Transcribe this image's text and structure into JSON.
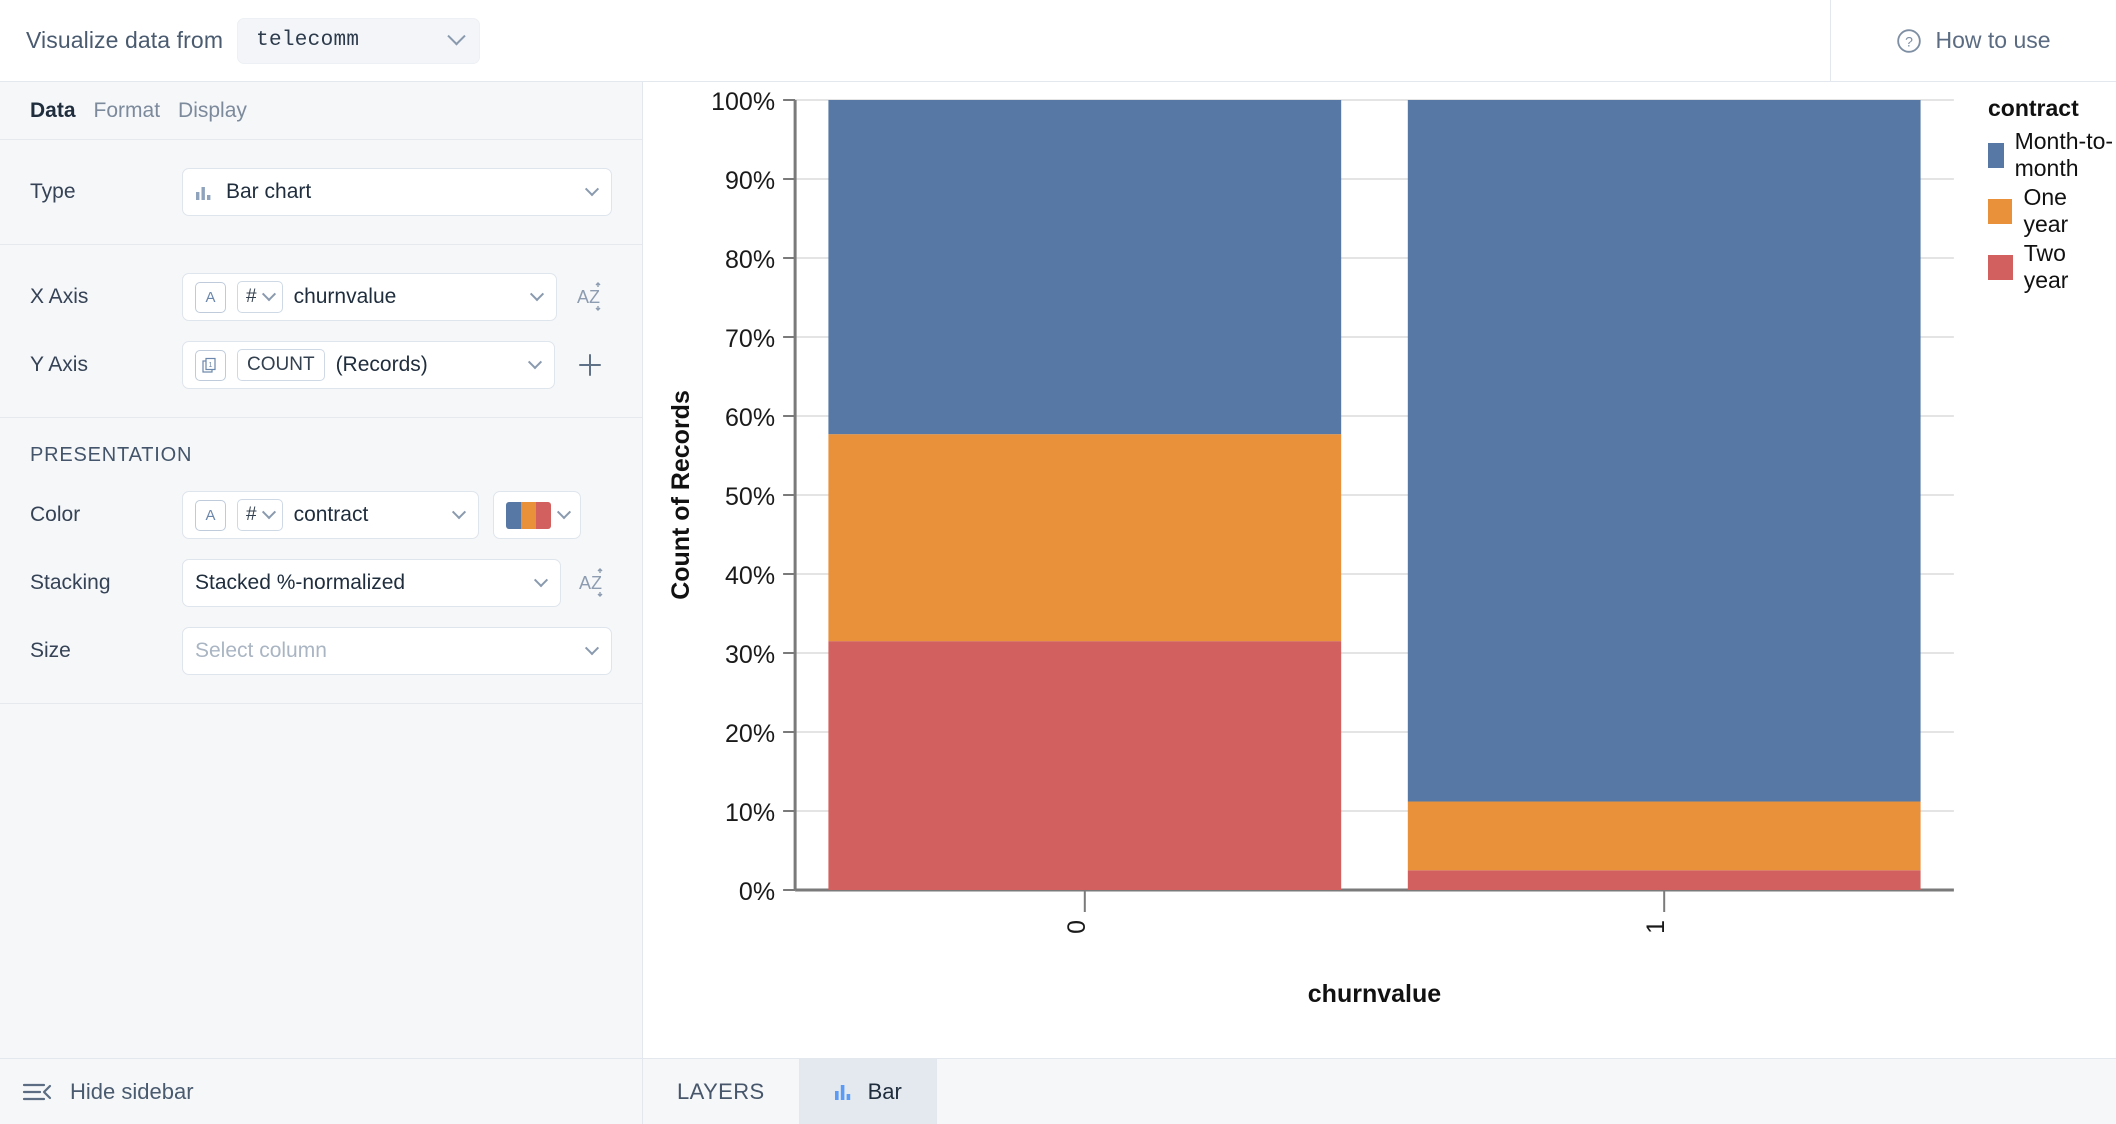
{
  "topbar": {
    "visualize_label": "Visualize data from",
    "dataset": "telecomm",
    "dataset_chevron_icon": "chevron-down-icon",
    "help_icon": "question-circle-icon",
    "help_label": "How to use"
  },
  "sidebar": {
    "tabs": [
      {
        "label": "Data",
        "active": true
      },
      {
        "label": "Format",
        "active": false
      },
      {
        "label": "Display",
        "active": false
      }
    ],
    "type_row": {
      "label": "Type",
      "icon": "bar-chart-icon",
      "value": "Bar chart"
    },
    "x_axis_row": {
      "label": "X Axis",
      "type_icon": "text-type-icon",
      "type_badge": "A",
      "agg_badge": "#",
      "value": "churnvalue",
      "sort_icon": "sort-az-icon"
    },
    "y_axis_row": {
      "label": "Y Axis",
      "type_icon": "layers-icon",
      "agg_badge": "COUNT",
      "value": "(Records)",
      "add_icon": "plus-icon"
    },
    "presentation": {
      "title": "PRESENTATION",
      "color_row": {
        "label": "Color",
        "type_badge": "A",
        "agg_badge": "#",
        "value": "contract",
        "palette": [
          "#5778a4",
          "#e8913a",
          "#d1605e"
        ]
      },
      "stacking_row": {
        "label": "Stacking",
        "value": "Stacked %-normalized",
        "sort_icon": "sort-az-icon"
      },
      "size_row": {
        "label": "Size",
        "placeholder": "Select column",
        "value": ""
      }
    },
    "footer": {
      "icon": "hide-sidebar-icon",
      "label": "Hide sidebar"
    }
  },
  "bottom_tabs": [
    {
      "label": "LAYERS",
      "icon": "",
      "active": false
    },
    {
      "label": "Bar",
      "icon": "bar-chart-icon",
      "active": true
    }
  ],
  "chart_data": {
    "type": "bar",
    "subtype": "stacked-100-percent",
    "title": "",
    "xlabel": "churnvalue",
    "ylabel": "Count of Records",
    "categories": [
      "0",
      "1"
    ],
    "ylim": [
      0,
      100
    ],
    "ytick_labels": [
      "0%",
      "10%",
      "20%",
      "30%",
      "40%",
      "50%",
      "60%",
      "70%",
      "80%",
      "90%",
      "100%"
    ],
    "ytick_values": [
      0,
      10,
      20,
      30,
      40,
      50,
      60,
      70,
      80,
      90,
      100
    ],
    "grid": true,
    "legend_position": "right",
    "legend_title": "contract",
    "series": [
      {
        "name": "Two year",
        "color": "#d1605e",
        "values": [
          31.5,
          2.5
        ]
      },
      {
        "name": "One year",
        "color": "#e8913a",
        "values": [
          26.2,
          8.7
        ]
      },
      {
        "name": "Month-to-month",
        "color": "#5778a4",
        "values": [
          42.3,
          88.8
        ]
      }
    ]
  }
}
